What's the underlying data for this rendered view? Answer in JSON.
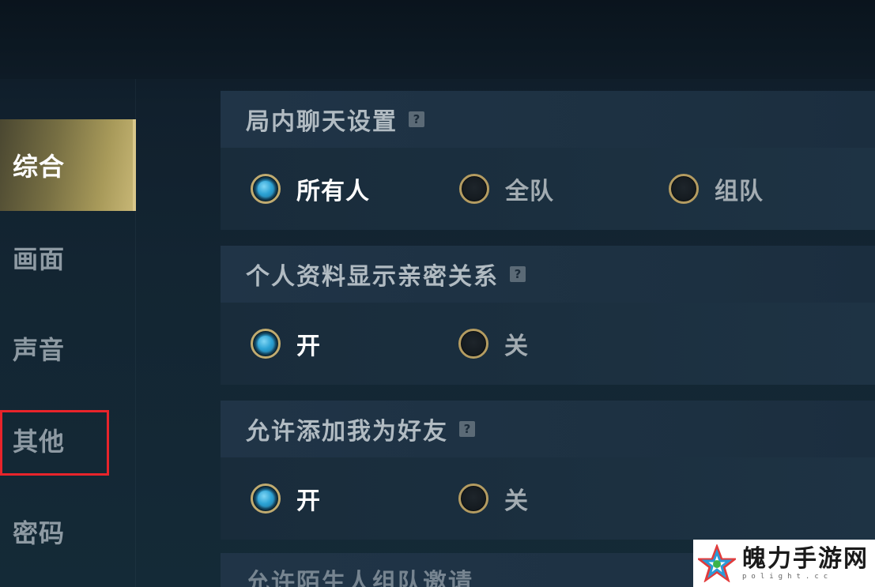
{
  "sidebar": {
    "items": [
      {
        "label": "综合",
        "active": true
      },
      {
        "label": "画面",
        "active": false
      },
      {
        "label": "声音",
        "active": false
      },
      {
        "label": "其他",
        "active": false
      },
      {
        "label": "密码",
        "active": false
      }
    ],
    "highlighted_item": "其他",
    "highlight_color": "#e8242b"
  },
  "sections": [
    {
      "title": "局内聊天设置",
      "help": "?",
      "options": [
        {
          "label": "所有人",
          "selected": true
        },
        {
          "label": "全队",
          "selected": false
        },
        {
          "label": "组队",
          "selected": false
        }
      ]
    },
    {
      "title": "个人资料显示亲密关系",
      "help": "?",
      "options": [
        {
          "label": "开",
          "selected": true
        },
        {
          "label": "关",
          "selected": false
        }
      ]
    },
    {
      "title": "允许添加我为好友",
      "help": "?",
      "options": [
        {
          "label": "开",
          "selected": true
        },
        {
          "label": "关",
          "selected": false
        }
      ]
    },
    {
      "title": "允许陌生人组队邀请",
      "help": "?"
    }
  ],
  "watermark": {
    "title": "魄力手游网",
    "subtitle": "polight.cc"
  },
  "colors": {
    "accent_gold": "#c0ab70",
    "radio_selected": "#39a9d6",
    "active_tab": "#a89a5a"
  }
}
